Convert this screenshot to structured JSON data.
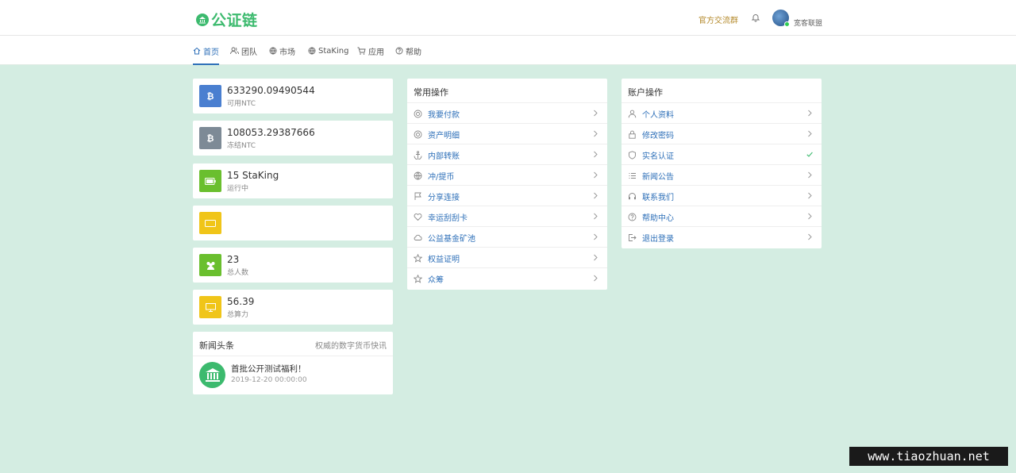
{
  "header": {
    "logo_text": "公证链",
    "group_link": "官方交流群",
    "username": "宽客联盟"
  },
  "nav": {
    "items": [
      {
        "label": "首页",
        "icon": "home-icon"
      },
      {
        "label": "团队",
        "icon": "users-icon"
      },
      {
        "label": "市场",
        "icon": "globe-icon"
      },
      {
        "label": "StaKing",
        "icon": "globe-icon"
      },
      {
        "label": "应用",
        "icon": "cart-icon"
      },
      {
        "label": "帮助",
        "icon": "help-icon"
      }
    ],
    "active": "首页"
  },
  "stats": [
    {
      "value": "633290.09490544",
      "label": "可用NTC",
      "icon": "bitcoin-icon",
      "color": "#4a7fd0"
    },
    {
      "value": "108053.29387666",
      "label": "冻结NTC",
      "icon": "bitcoin-icon",
      "color": "#7d8a96"
    },
    {
      "value": "15 StaKing",
      "label": "运行中",
      "icon": "battery-icon",
      "color": "#6abf2e"
    },
    {
      "value": "",
      "label": "",
      "icon": "card-icon",
      "color": "#f0c519"
    },
    {
      "value": "23",
      "label": "总人数",
      "icon": "team-icon",
      "color": "#6abf2e"
    },
    {
      "value": "56.39",
      "label": "总算力",
      "icon": "monitor-icon",
      "color": "#f0c519"
    }
  ],
  "news": {
    "title": "新闻头条",
    "subtitle": "权威的数字货币快讯",
    "item_title": "首批公开测试福利！",
    "item_date": "2019-12-20 00:00:00"
  },
  "common_ops": {
    "title": "常用操作",
    "items": [
      {
        "label": "我要付款",
        "icon": "coin-icon"
      },
      {
        "label": "资产明细",
        "icon": "coin-icon"
      },
      {
        "label": "内部转账",
        "icon": "anchor-icon"
      },
      {
        "label": "冲/提币",
        "icon": "globe-icon"
      },
      {
        "label": "分享连接",
        "icon": "flag-icon"
      },
      {
        "label": "幸运刮刮卡",
        "icon": "heart-icon"
      },
      {
        "label": "公益基金矿池",
        "icon": "cloud-icon"
      },
      {
        "label": "权益证明",
        "icon": "star-icon"
      },
      {
        "label": "众筹",
        "icon": "star-icon"
      }
    ]
  },
  "account_ops": {
    "title": "账户操作",
    "items": [
      {
        "label": "个人资料",
        "icon": "user-icon",
        "status": "chevron"
      },
      {
        "label": "修改密码",
        "icon": "lock-icon",
        "status": "chevron"
      },
      {
        "label": "实名认证",
        "icon": "shield-icon",
        "status": "check"
      },
      {
        "label": "新闻公告",
        "icon": "list-icon",
        "status": "chevron"
      },
      {
        "label": "联系我们",
        "icon": "headset-icon",
        "status": "chevron"
      },
      {
        "label": "帮助中心",
        "icon": "help-icon",
        "status": "chevron"
      },
      {
        "label": "退出登录",
        "icon": "logout-icon",
        "status": "chevron"
      }
    ]
  },
  "watermark": "www.tiaozhuan.net",
  "colors": {
    "background": "#d4ede2",
    "brand_green": "#3cba6e",
    "link_blue": "#2d6fb8",
    "check_green": "#3cba6e"
  }
}
